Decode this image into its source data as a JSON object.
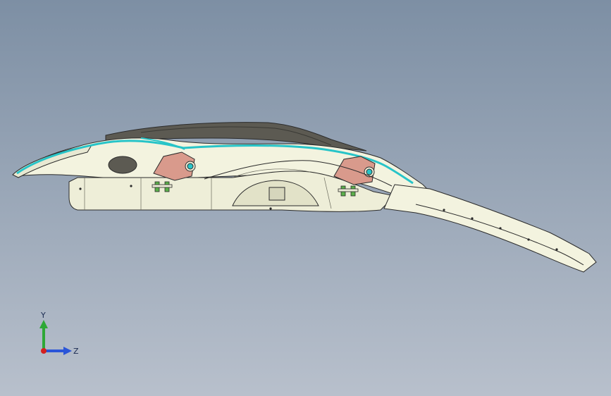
{
  "viewport": {
    "background_top": "#7d8fa4",
    "background_bottom": "#b8c0cc"
  },
  "model": {
    "part_color": "#f3f3df",
    "edge_color": "#2b2b2b",
    "highlight_color": "#27c4c8",
    "bracket_color": "#d99a8c",
    "bolt_color": "#5bb04a",
    "shadow_color": "#5c5a52"
  },
  "triad": {
    "y_label": "Y",
    "z_label": "Z",
    "y_color": "#2ea836",
    "z_color": "#2a55d8",
    "x_color": "#d42020"
  }
}
